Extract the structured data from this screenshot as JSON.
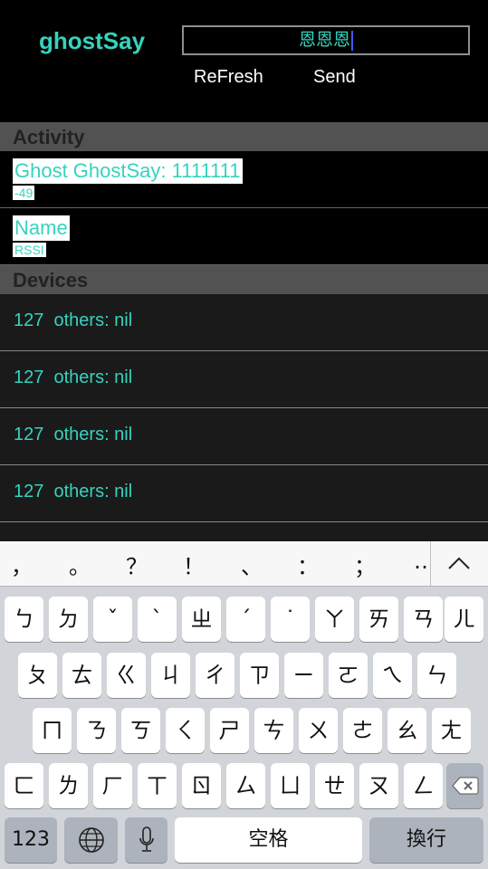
{
  "header": {
    "app_title": "ghostSay",
    "message_value": "恩恩恩",
    "refresh_label": "ReFresh",
    "send_label": "Send"
  },
  "activity": {
    "section_title": "Activity",
    "rows": [
      {
        "title": "Ghost GhostSay: 1111111",
        "subtitle": "-49"
      },
      {
        "title": "Name",
        "subtitle": "RSSI"
      }
    ]
  },
  "devices": {
    "section_title": "Devices",
    "rows": [
      {
        "text": "127  others: nil"
      },
      {
        "text": "127  others: nil"
      },
      {
        "text": "127  others: nil"
      },
      {
        "text": "127  others: nil"
      }
    ]
  },
  "keyboard": {
    "candidates": [
      "，",
      "。",
      "？",
      "！",
      "、",
      "：",
      "；",
      "‥"
    ],
    "collapse_icon": "chevron-up-icon",
    "row1": [
      "ㄅ",
      "ㄉ",
      "ˇ",
      "ˋ",
      "ㄓ",
      "ˊ",
      "˙",
      "ㄚ",
      "ㄞ",
      "ㄢ",
      "ㄦ"
    ],
    "row2": [
      "ㄆ",
      "ㄊ",
      "ㄍ",
      "ㄐ",
      "ㄔ",
      "ㄗ",
      "ㄧ",
      "ㄛ",
      "ㄟ",
      "ㄣ"
    ],
    "row3": [
      "ㄇ",
      "ㄋ",
      "ㄎ",
      "ㄑ",
      "ㄕ",
      "ㄘ",
      "ㄨ",
      "ㄜ",
      "ㄠ",
      "ㄤ"
    ],
    "row4": [
      "ㄈ",
      "ㄌ",
      "ㄏ",
      "ㄒ",
      "ㄖ",
      "ㄙ",
      "ㄩ",
      "ㄝ",
      "ㄡ",
      "ㄥ"
    ],
    "backspace_icon": "backspace-icon",
    "numbers_label": "123",
    "globe_icon": "globe-icon",
    "mic_icon": "microphone-icon",
    "space_label": "空格",
    "return_label": "換行"
  }
}
